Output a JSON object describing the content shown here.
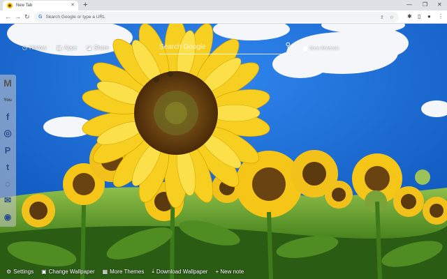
{
  "browser": {
    "tab_title": "New Tab",
    "tab_close": "✕",
    "new_tab": "+",
    "omnibox_placeholder": "Search Google or type a URL",
    "minimize": "—",
    "restore": "❐",
    "close": "✕"
  },
  "nav": {
    "back": "←",
    "forward": "→",
    "reload": "↻"
  },
  "top_links": [
    {
      "label": "History",
      "icon": "history-icon",
      "glyph": "◷"
    },
    {
      "label": "Apps",
      "icon": "apps-icon",
      "glyph": "▦"
    },
    {
      "label": "Share",
      "icon": "share-icon",
      "glyph": "◪"
    }
  ],
  "search": {
    "placeholder": "Search Google",
    "icon": "search-icon"
  },
  "shortcuts": {
    "label": "Show Shortcuts"
  },
  "side_icons": [
    {
      "name": "gmail-icon",
      "glyph": "M"
    },
    {
      "name": "youtube-icon",
      "glyph": "You"
    },
    {
      "name": "facebook-icon",
      "glyph": "f"
    },
    {
      "name": "instagram-icon",
      "glyph": "◎"
    },
    {
      "name": "pinterest-icon",
      "glyph": "P"
    },
    {
      "name": "twitter-icon",
      "glyph": "t"
    },
    {
      "name": "whatsapp-icon",
      "glyph": "◌"
    },
    {
      "name": "mail-icon",
      "glyph": "✉"
    },
    {
      "name": "reddit-icon",
      "glyph": "◉"
    }
  ],
  "bottom": {
    "settings": "Settings",
    "change_wallpaper": "Change Wallpaper",
    "more_themes": "More Themes",
    "download_wallpaper": "Download Wallpaper",
    "new_note": "+ New note"
  },
  "colors": {
    "sky": "#1f6fd6",
    "petal": "#f5c518",
    "leaf": "#3c7a1e"
  }
}
